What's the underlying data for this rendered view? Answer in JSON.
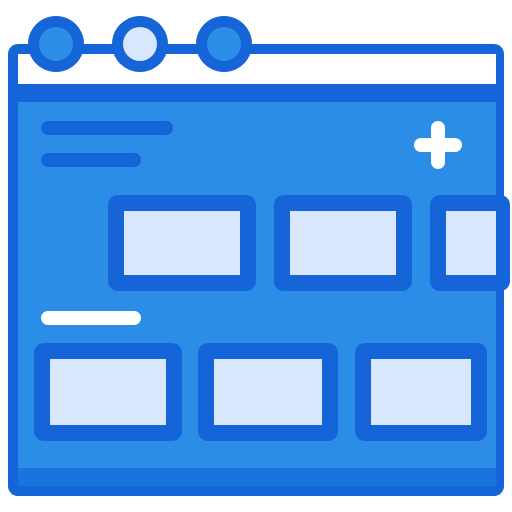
{
  "icon": {
    "name": "browser-window-carousel-icon",
    "colors": {
      "outline": "#1565d8",
      "body": "#2b8de6",
      "titlebar": "#ffffff",
      "dot_light": "#d8e7fb",
      "card_fill": "#d8e7fb",
      "text_line_light": "#ffffff",
      "plus": "#ffffff"
    },
    "titlebar_dots": [
      {
        "name": "dot-1",
        "style": "dark"
      },
      {
        "name": "dot-2",
        "style": "light"
      },
      {
        "name": "dot-3",
        "style": "dark"
      }
    ],
    "rows": [
      {
        "name": "top-carousel-row",
        "cards": 3,
        "last_card_clipped": true
      },
      {
        "name": "bottom-carousel-row",
        "cards": 3,
        "last_card_clipped": false
      }
    ],
    "add_icon": "plus-icon"
  }
}
